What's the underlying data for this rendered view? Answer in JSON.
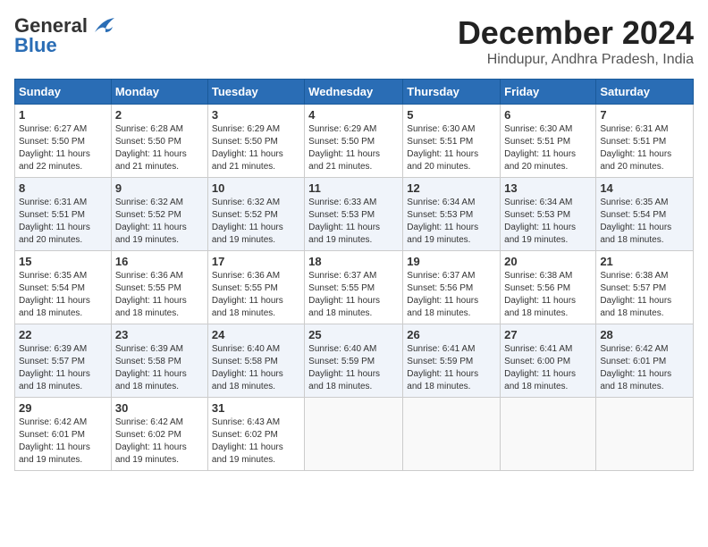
{
  "logo": {
    "line1": "General",
    "line2": "Blue"
  },
  "title": "December 2024",
  "subtitle": "Hindupur, Andhra Pradesh, India",
  "headers": [
    "Sunday",
    "Monday",
    "Tuesday",
    "Wednesday",
    "Thursday",
    "Friday",
    "Saturday"
  ],
  "weeks": [
    [
      {
        "day": "1",
        "info": "Sunrise: 6:27 AM\nSunset: 5:50 PM\nDaylight: 11 hours\nand 22 minutes."
      },
      {
        "day": "2",
        "info": "Sunrise: 6:28 AM\nSunset: 5:50 PM\nDaylight: 11 hours\nand 21 minutes."
      },
      {
        "day": "3",
        "info": "Sunrise: 6:29 AM\nSunset: 5:50 PM\nDaylight: 11 hours\nand 21 minutes."
      },
      {
        "day": "4",
        "info": "Sunrise: 6:29 AM\nSunset: 5:50 PM\nDaylight: 11 hours\nand 21 minutes."
      },
      {
        "day": "5",
        "info": "Sunrise: 6:30 AM\nSunset: 5:51 PM\nDaylight: 11 hours\nand 20 minutes."
      },
      {
        "day": "6",
        "info": "Sunrise: 6:30 AM\nSunset: 5:51 PM\nDaylight: 11 hours\nand 20 minutes."
      },
      {
        "day": "7",
        "info": "Sunrise: 6:31 AM\nSunset: 5:51 PM\nDaylight: 11 hours\nand 20 minutes."
      }
    ],
    [
      {
        "day": "8",
        "info": "Sunrise: 6:31 AM\nSunset: 5:51 PM\nDaylight: 11 hours\nand 20 minutes."
      },
      {
        "day": "9",
        "info": "Sunrise: 6:32 AM\nSunset: 5:52 PM\nDaylight: 11 hours\nand 19 minutes."
      },
      {
        "day": "10",
        "info": "Sunrise: 6:32 AM\nSunset: 5:52 PM\nDaylight: 11 hours\nand 19 minutes."
      },
      {
        "day": "11",
        "info": "Sunrise: 6:33 AM\nSunset: 5:53 PM\nDaylight: 11 hours\nand 19 minutes."
      },
      {
        "day": "12",
        "info": "Sunrise: 6:34 AM\nSunset: 5:53 PM\nDaylight: 11 hours\nand 19 minutes."
      },
      {
        "day": "13",
        "info": "Sunrise: 6:34 AM\nSunset: 5:53 PM\nDaylight: 11 hours\nand 19 minutes."
      },
      {
        "day": "14",
        "info": "Sunrise: 6:35 AM\nSunset: 5:54 PM\nDaylight: 11 hours\nand 18 minutes."
      }
    ],
    [
      {
        "day": "15",
        "info": "Sunrise: 6:35 AM\nSunset: 5:54 PM\nDaylight: 11 hours\nand 18 minutes."
      },
      {
        "day": "16",
        "info": "Sunrise: 6:36 AM\nSunset: 5:55 PM\nDaylight: 11 hours\nand 18 minutes."
      },
      {
        "day": "17",
        "info": "Sunrise: 6:36 AM\nSunset: 5:55 PM\nDaylight: 11 hours\nand 18 minutes."
      },
      {
        "day": "18",
        "info": "Sunrise: 6:37 AM\nSunset: 5:55 PM\nDaylight: 11 hours\nand 18 minutes."
      },
      {
        "day": "19",
        "info": "Sunrise: 6:37 AM\nSunset: 5:56 PM\nDaylight: 11 hours\nand 18 minutes."
      },
      {
        "day": "20",
        "info": "Sunrise: 6:38 AM\nSunset: 5:56 PM\nDaylight: 11 hours\nand 18 minutes."
      },
      {
        "day": "21",
        "info": "Sunrise: 6:38 AM\nSunset: 5:57 PM\nDaylight: 11 hours\nand 18 minutes."
      }
    ],
    [
      {
        "day": "22",
        "info": "Sunrise: 6:39 AM\nSunset: 5:57 PM\nDaylight: 11 hours\nand 18 minutes."
      },
      {
        "day": "23",
        "info": "Sunrise: 6:39 AM\nSunset: 5:58 PM\nDaylight: 11 hours\nand 18 minutes."
      },
      {
        "day": "24",
        "info": "Sunrise: 6:40 AM\nSunset: 5:58 PM\nDaylight: 11 hours\nand 18 minutes."
      },
      {
        "day": "25",
        "info": "Sunrise: 6:40 AM\nSunset: 5:59 PM\nDaylight: 11 hours\nand 18 minutes."
      },
      {
        "day": "26",
        "info": "Sunrise: 6:41 AM\nSunset: 5:59 PM\nDaylight: 11 hours\nand 18 minutes."
      },
      {
        "day": "27",
        "info": "Sunrise: 6:41 AM\nSunset: 6:00 PM\nDaylight: 11 hours\nand 18 minutes."
      },
      {
        "day": "28",
        "info": "Sunrise: 6:42 AM\nSunset: 6:01 PM\nDaylight: 11 hours\nand 18 minutes."
      }
    ],
    [
      {
        "day": "29",
        "info": "Sunrise: 6:42 AM\nSunset: 6:01 PM\nDaylight: 11 hours\nand 19 minutes."
      },
      {
        "day": "30",
        "info": "Sunrise: 6:42 AM\nSunset: 6:02 PM\nDaylight: 11 hours\nand 19 minutes."
      },
      {
        "day": "31",
        "info": "Sunrise: 6:43 AM\nSunset: 6:02 PM\nDaylight: 11 hours\nand 19 minutes."
      },
      {
        "day": "",
        "info": ""
      },
      {
        "day": "",
        "info": ""
      },
      {
        "day": "",
        "info": ""
      },
      {
        "day": "",
        "info": ""
      }
    ]
  ]
}
